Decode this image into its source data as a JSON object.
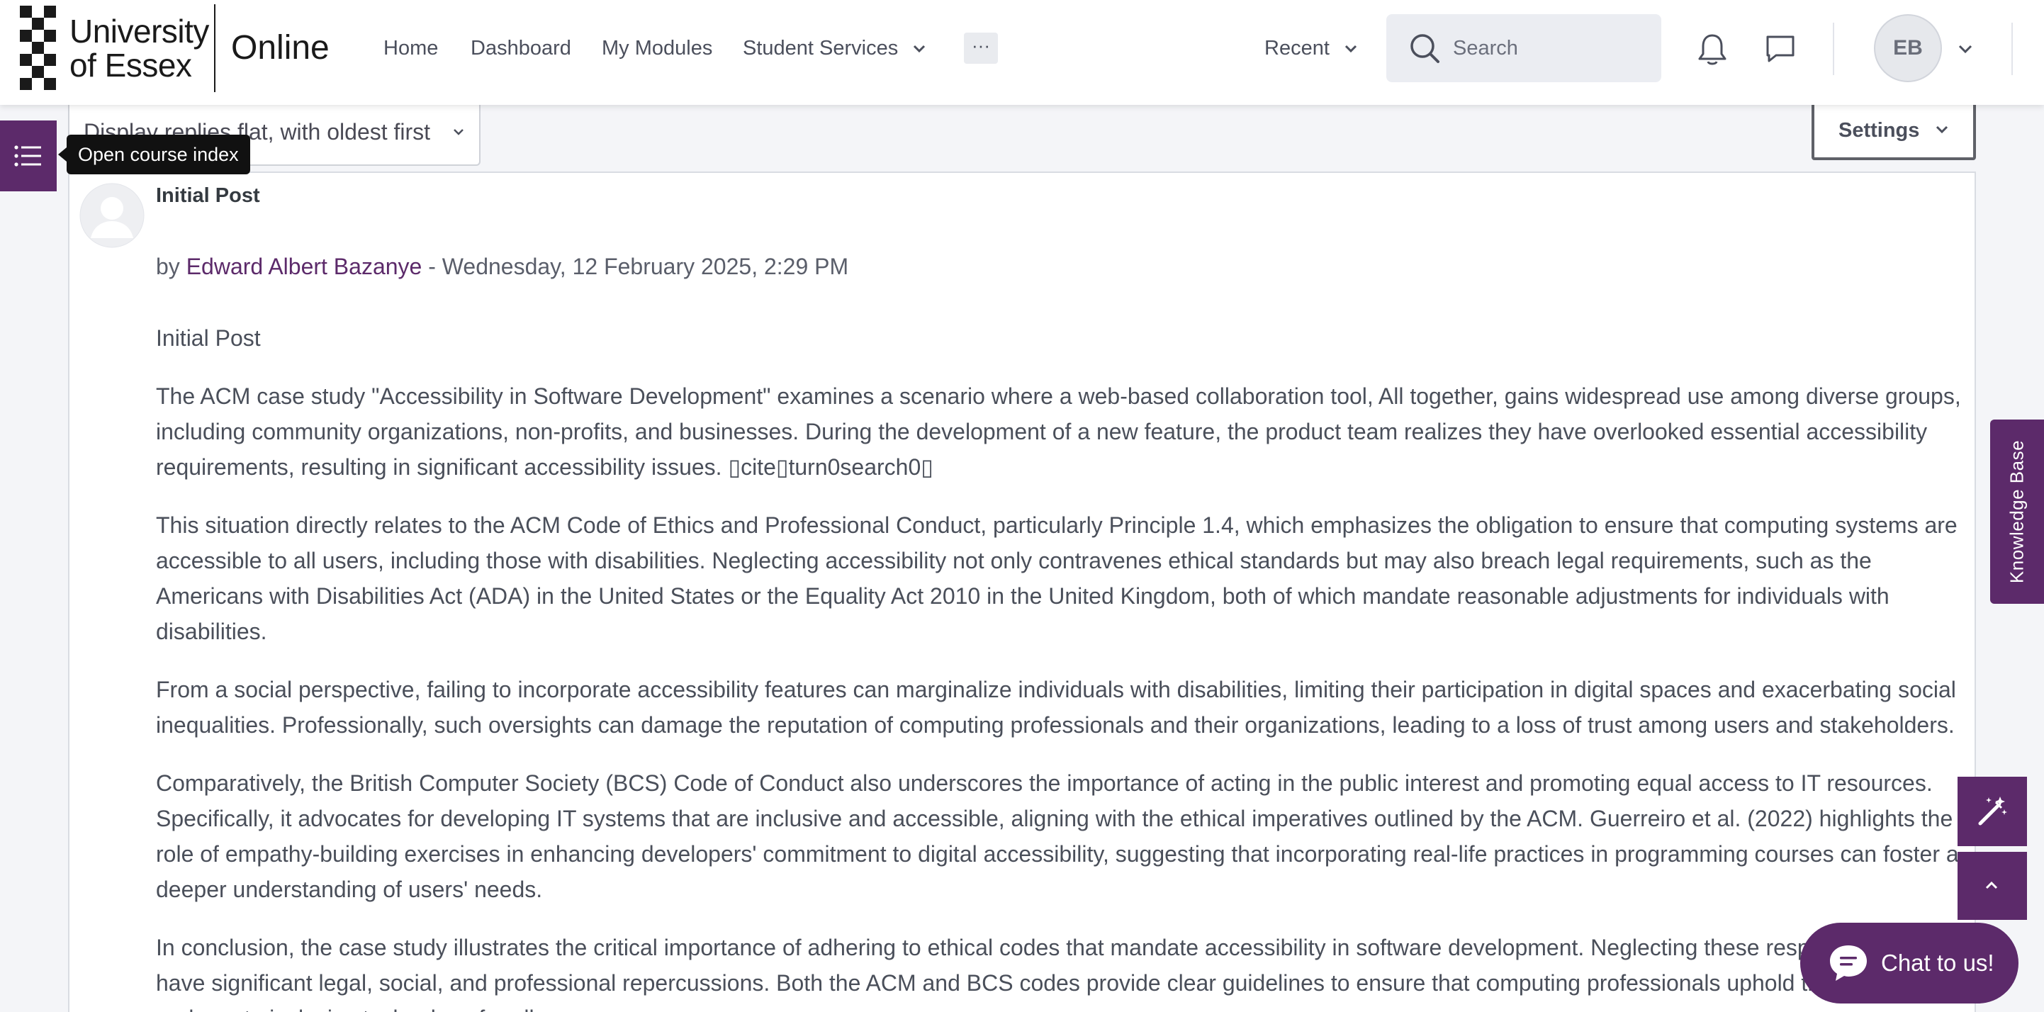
{
  "brand": {
    "line1": "University",
    "line2": "of Essex",
    "online": "Online"
  },
  "nav": {
    "home": "Home",
    "dashboard": "Dashboard",
    "my_modules": "My Modules",
    "student_services": "Student Services",
    "more": "···",
    "recent": "Recent"
  },
  "search": {
    "placeholder": "Search"
  },
  "user": {
    "initials": "EB"
  },
  "course_index": {
    "tooltip": "Open course index"
  },
  "toolbar": {
    "display_mode": "Display replies flat, with oldest first",
    "settings_label": "Settings"
  },
  "post": {
    "subject": "Initial Post",
    "by_prefix": "by",
    "author": "Edward Albert Bazanye",
    "date_sep": " - ",
    "date": "Wednesday, 12 February 2025, 2:29 PM",
    "paragraphs": [
      "Initial Post",
      "The ACM case study \"Accessibility in Software Development\" examines a scenario where a web-based collaboration tool, All together, gains widespread use among diverse groups, including community organizations, non-profits, and businesses. During the development of a new feature, the product team realizes they have overlooked essential accessibility requirements, resulting in significant accessibility issues. ▯cite▯turn0search0▯",
      "This situation directly relates to the ACM Code of Ethics and Professional Conduct, particularly Principle 1.4, which emphasizes the obligation to ensure that computing systems are accessible to all users, including those with disabilities. Neglecting accessibility not only contravenes ethical standards but may also breach legal requirements, such as the Americans with Disabilities Act (ADA) in the United States or the Equality Act 2010 in the United Kingdom, both of which mandate reasonable adjustments for individuals with disabilities.",
      "From a social perspective, failing to incorporate accessibility features can marginalize individuals with disabilities, limiting their participation in digital spaces and exacerbating social inequalities. Professionally, such oversights can damage the reputation of computing professionals and their organizations, leading to a loss of trust among users and stakeholders.",
      "Comparatively, the British Computer Society (BCS) Code of Conduct also underscores the importance of acting in the public interest and promoting equal access to IT resources. Specifically, it advocates for developing IT systems that are inclusive and accessible, aligning with the ethical imperatives outlined by the ACM. Guerreiro et al. (2022) highlights the role of empathy-building exercises in enhancing developers' commitment to digital accessibility, suggesting that incorporating real-life practices in programming courses can foster a deeper understanding of users' needs.",
      "In conclusion, the case study illustrates the critical importance of adhering to ethical codes that mandate accessibility in software development. Neglecting these responsibilities can have significant legal, social, and professional repercussions. Both the ACM and BCS codes provide clear guidelines to ensure that computing professionals uphold these standards and create inclusive technology for all users."
    ]
  },
  "widgets": {
    "knowledge_base": "Knowledge Base",
    "chat": "Chat to us!"
  },
  "colors": {
    "brand_purple": "#5c2a6a",
    "text": "#4a4f5a",
    "navbar_bg": "#ffffff",
    "page_bg": "#f4f5f8"
  },
  "icons": {
    "course_index": "list-icon",
    "search": "search-icon",
    "notifications": "bell-icon",
    "messages": "chat-bubble-icon",
    "magic": "magic-wand-icon",
    "back_to_top": "chevron-up-icon",
    "chat": "chat-icon"
  }
}
